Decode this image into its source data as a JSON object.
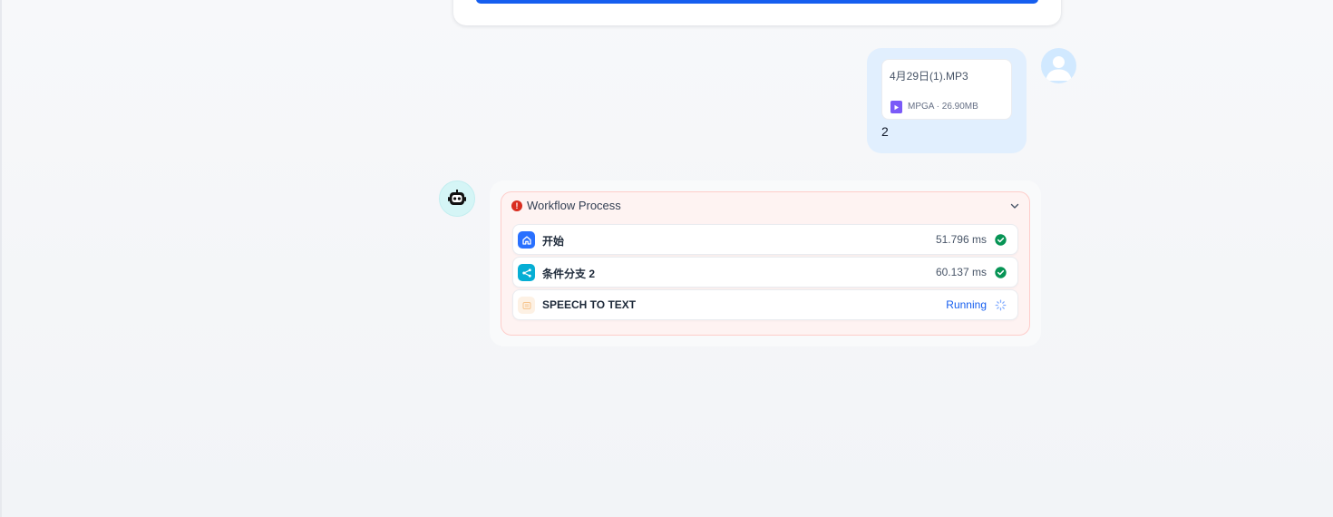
{
  "user_message": {
    "file": {
      "name": "4月29日(1).MP3",
      "meta": "MPGA · 26.90MB",
      "icon": "audio-file-icon"
    },
    "text": "2"
  },
  "workflow": {
    "title": "Workflow Process",
    "status_icon": "error-icon",
    "nodes": [
      {
        "title": "开始",
        "time": "51.796 ms",
        "icon": "home-icon",
        "icon_color": "#2970ff",
        "status": "success"
      },
      {
        "title": "条件分支 2",
        "time": "60.137 ms",
        "icon": "branch-icon",
        "icon_color": "#06aed4",
        "status": "success"
      },
      {
        "title": "SPEECH TO TEXT",
        "status_text": "Running",
        "icon": "microphone-icon",
        "icon_color": "#fdead7",
        "status": "running"
      }
    ]
  },
  "colors": {
    "accent": "#155eef",
    "success": "#079455",
    "error": "#d92d20"
  }
}
